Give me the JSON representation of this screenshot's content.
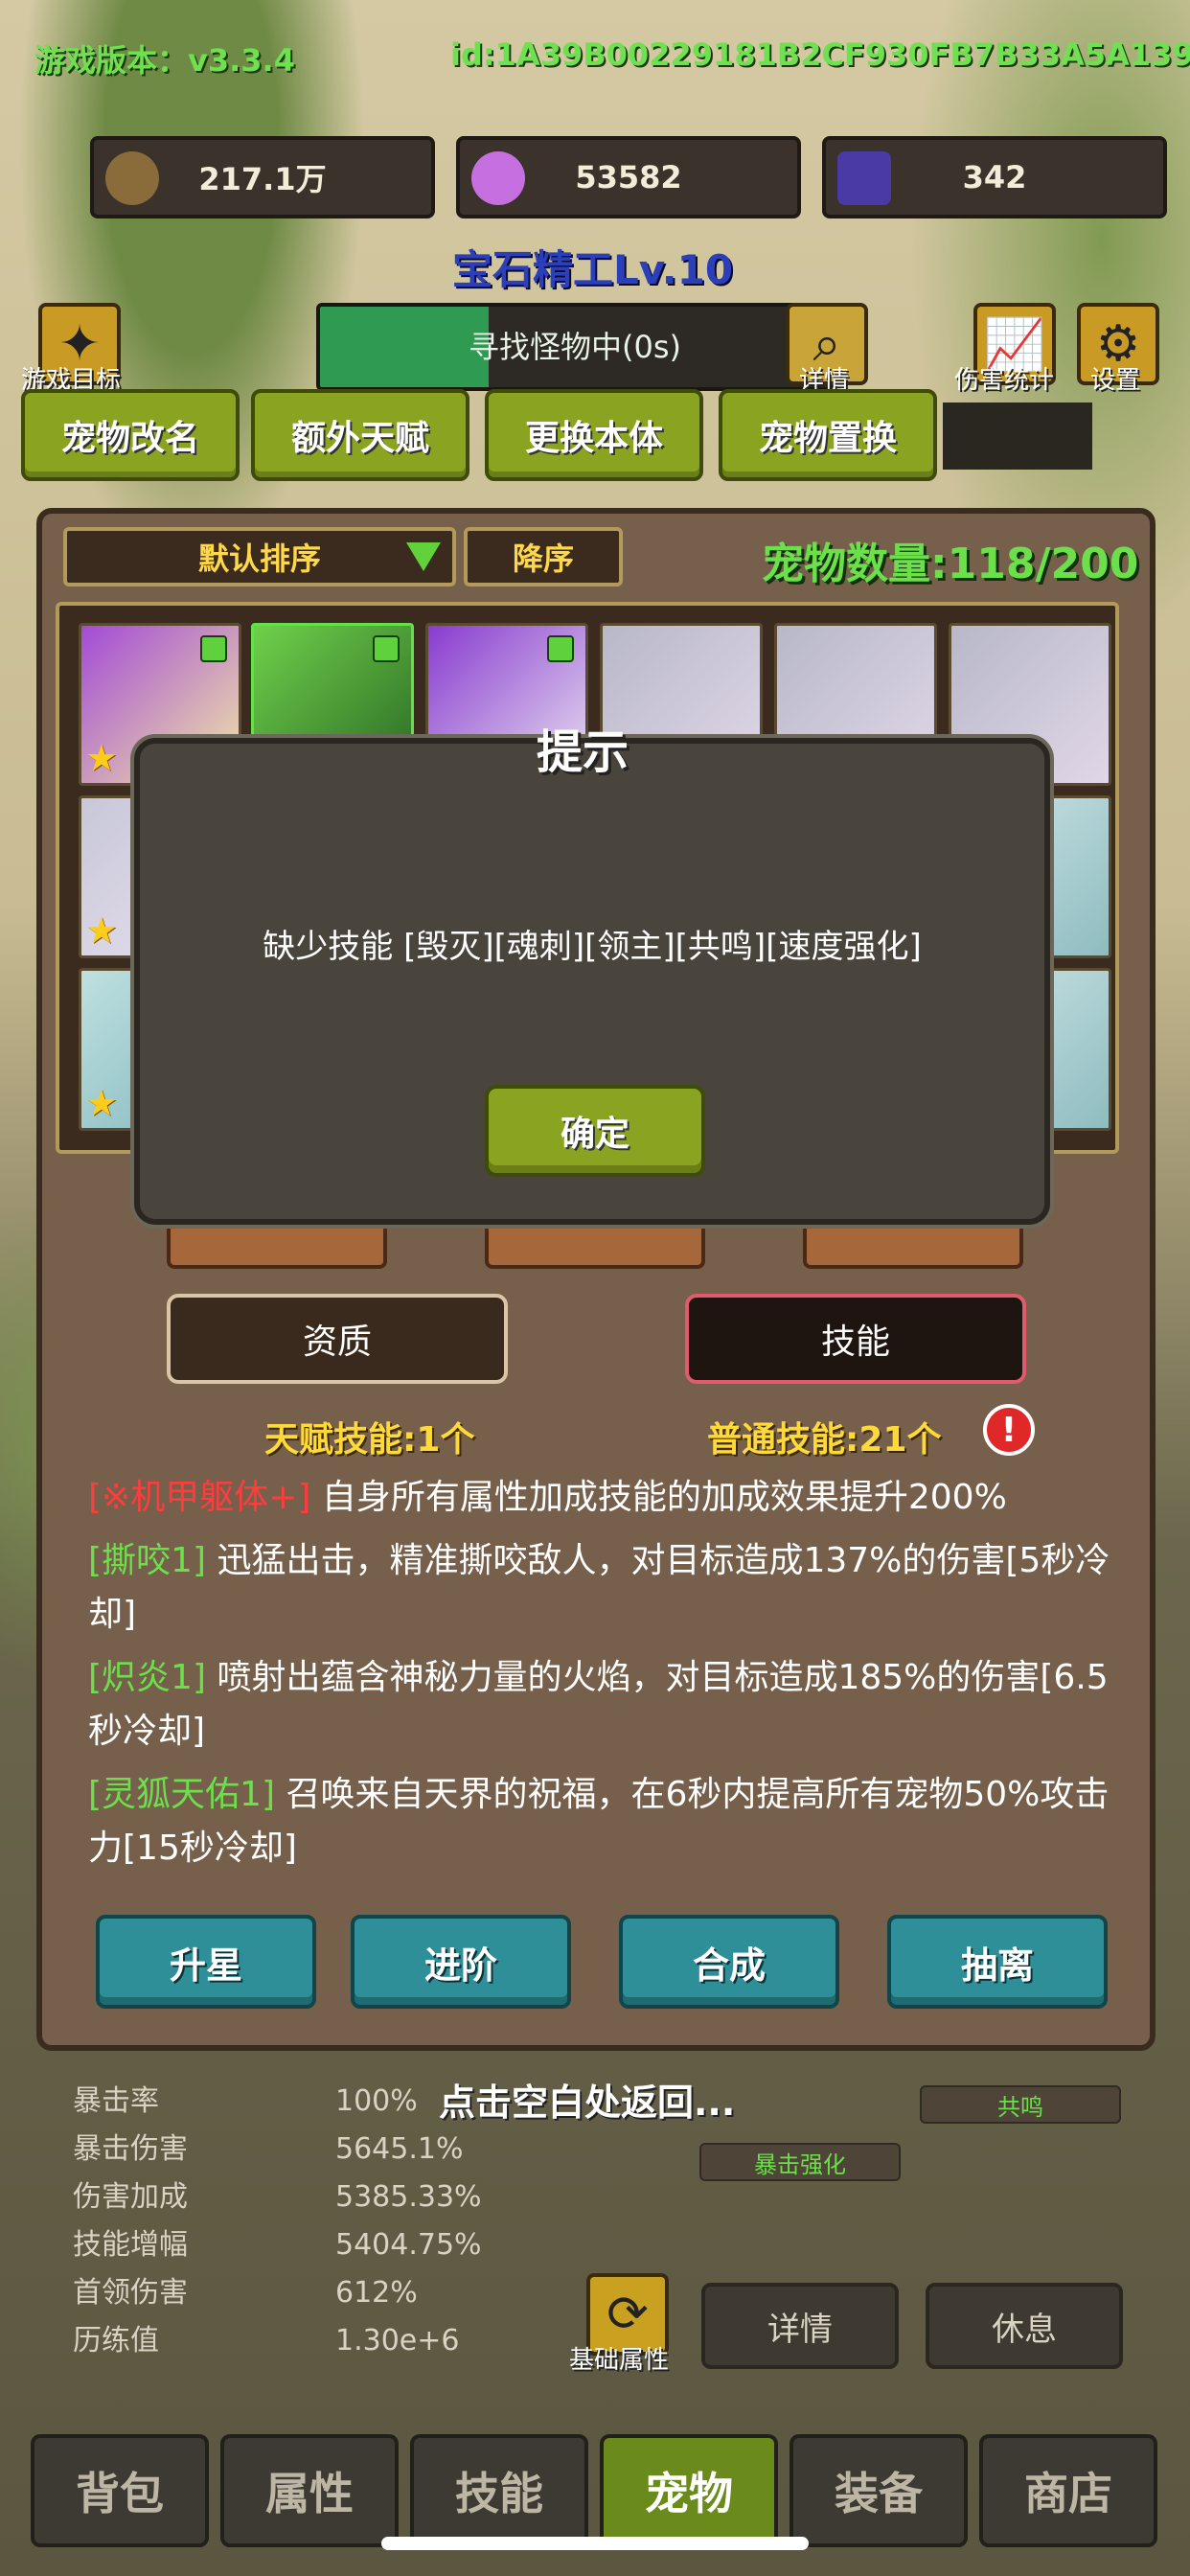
{
  "header": {
    "version": "游戏版本：v3.3.4",
    "id": "id:1A39B00229181B2CF930FB7B33A5A139"
  },
  "resources": [
    {
      "value": "217.1万",
      "icon": "coin-icon",
      "color": "#8a6b3a"
    },
    {
      "value": "53582",
      "icon": "crystal-icon",
      "color": "#c66fe0"
    },
    {
      "value": "342",
      "icon": "card-icon",
      "color": "#4a3aa6"
    }
  ],
  "title": "宝石精工Lv.10",
  "topbar": {
    "goal_label": "游戏目标",
    "search_status": "寻找怪物中(0s)",
    "search_progress_pct": 33,
    "detail_label": "详情",
    "damage_stats_label": "伤害统计",
    "settings_label": "设置"
  },
  "pet_actions": [
    "宠物改名",
    "额外天赋",
    "更换本体",
    "宠物置换"
  ],
  "panel": {
    "sort_label": "默认排序",
    "order_label": "降序",
    "pet_count": "宠物数量:118/200"
  },
  "dialog": {
    "title": "提示",
    "message": "缺少技能 [毁灭][魂刺][领主][共鸣][速度强化]",
    "ok_label": "确定"
  },
  "tabs": {
    "quality": "资质",
    "skill": "技能"
  },
  "counts": {
    "talent": "天赋技能:1个",
    "normal": "普通技能:21个"
  },
  "skills": [
    {
      "tag": "[※机甲躯体+]",
      "tag_color": "red",
      "desc": "自身所有属性加成技能的加成效果提升200%"
    },
    {
      "tag": "[撕咬1]",
      "tag_color": "green",
      "desc": "迅猛出击，精准撕咬敌人，对目标造成137%的伤害[5秒冷却]"
    },
    {
      "tag": "[炽炎1]",
      "tag_color": "green",
      "desc": "喷射出蕴含神秘力量的火焰，对目标造成185%的伤害[6.5秒冷却]"
    },
    {
      "tag": "[灵狐天佑1]",
      "tag_color": "green",
      "desc": "召唤来自天界的祝福，在6秒内提高所有宠物50%攻击力[15秒冷却]"
    }
  ],
  "action_buttons": [
    "升星",
    "进阶",
    "合成",
    "抽离"
  ],
  "stats": [
    {
      "label": "暴击率",
      "value": "100%"
    },
    {
      "label": "暴击伤害",
      "value": "5645.1%"
    },
    {
      "label": "伤害加成",
      "value": "5385.33%"
    },
    {
      "label": "技能增幅",
      "value": "5404.75%"
    },
    {
      "label": "首领伤害",
      "value": "612%"
    },
    {
      "label": "历练值",
      "value": "1.30e+6"
    }
  ],
  "return_hint": "点击空白处返回...",
  "chips": [
    "共鸣",
    "暴击强化"
  ],
  "base_attr_label": "基础属性",
  "detail_button": "详情",
  "rest_button": "休息",
  "bottom_nav": [
    "背包",
    "属性",
    "技能",
    "宠物",
    "装备",
    "商店"
  ],
  "active_tab": "宠物"
}
